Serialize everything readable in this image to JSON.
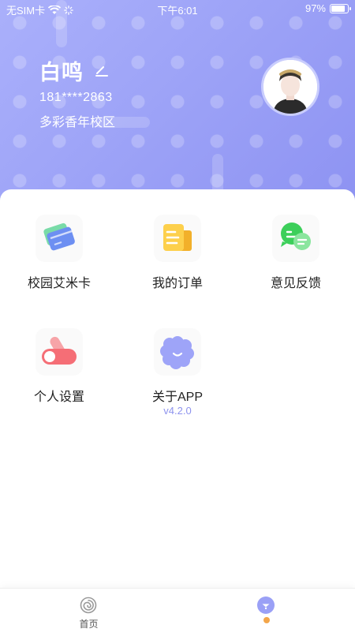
{
  "status_bar": {
    "carrier": "无SIM卡",
    "time": "下午6:01",
    "battery": "97%"
  },
  "profile": {
    "name": "白鸣",
    "phone": "181****2863",
    "school": "多彩香年校区"
  },
  "menu": [
    {
      "label": "校园艾米卡",
      "icon": "card-icon"
    },
    {
      "label": "我的订单",
      "icon": "order-icon"
    },
    {
      "label": "意见反馈",
      "icon": "feedback-icon"
    },
    {
      "label": "个人设置",
      "icon": "toggle-settings-icon"
    },
    {
      "label": "关于APP",
      "icon": "about-app-icon",
      "version": "v4.2.0"
    }
  ],
  "tabbar": {
    "home_label": "首页",
    "home_icon": "home-swirl-icon",
    "me_icon": "profile-tab-icon"
  },
  "colors": {
    "accent": "#9da3f7",
    "version_text": "#8e93ee",
    "badge": "#f3a64a"
  }
}
